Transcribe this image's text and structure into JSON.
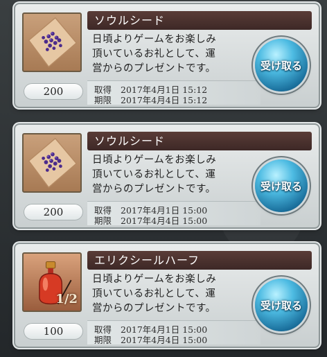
{
  "items": [
    {
      "name": "ソウルシード",
      "desc_lines": [
        "日頃よりゲームをお楽しみ",
        "頂いているお礼として、運",
        "営からのプレゼントです。"
      ],
      "quantity": "200",
      "acquired_label": "取得",
      "acquired": "2017年4月1日 15:12",
      "expiry_label": "期限",
      "expiry": "2017年4月4日 15:12",
      "button_label": "受け取る",
      "icon": "soul-seed-icon"
    },
    {
      "name": "ソウルシード",
      "desc_lines": [
        "日頃よりゲームをお楽しみ",
        "頂いているお礼として、運",
        "営からのプレゼントです。"
      ],
      "quantity": "200",
      "acquired_label": "取得",
      "acquired": "2017年4月1日 15:00",
      "expiry_label": "期限",
      "expiry": "2017年4月4日 15:00",
      "button_label": "受け取る",
      "icon": "soul-seed-icon"
    },
    {
      "name": "エリクシールハーフ",
      "desc_lines": [
        "日頃よりゲームをお楽しみ",
        "頂いているお礼として、運",
        "営からのプレゼントです。"
      ],
      "quantity": "100",
      "acquired_label": "取得",
      "acquired": "2017年4月1日 15:00",
      "expiry_label": "期限",
      "expiry": "2017年4月4日 15:00",
      "button_label": "受け取る",
      "icon": "elixir-half-icon",
      "icon_overlay": "1/2"
    }
  ]
}
